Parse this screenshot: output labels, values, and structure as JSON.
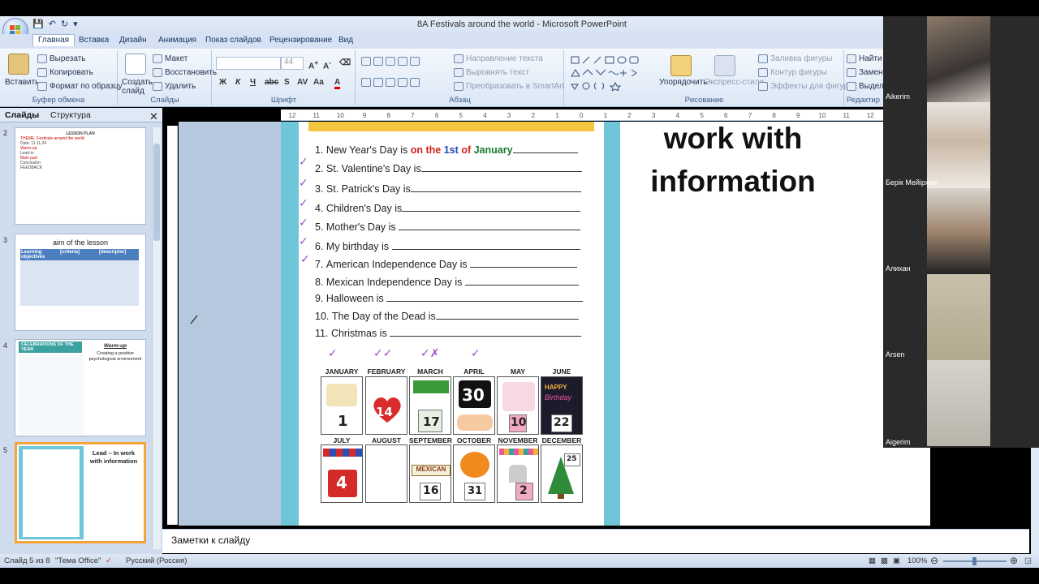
{
  "window": {
    "title": "8A Festivals around the world - Microsoft PowerPoint"
  },
  "ribbon_tabs": [
    "Главная",
    "Вставка",
    "Дизайн",
    "Анимация",
    "Показ слайдов",
    "Рецензирование",
    "Вид"
  ],
  "clipboard": {
    "paste": "Вставить",
    "cut": "Вырезать",
    "copy": "Копировать",
    "format_painter": "Формат по образцу",
    "label": "Буфер обмена"
  },
  "slides_group": {
    "create": "Создать слайд",
    "layout": "Макет",
    "reset": "Восстановить",
    "delete": "Удалить",
    "label": "Слайды"
  },
  "font_group": {
    "size": "44",
    "label": "Шрифт"
  },
  "paragraph_group": {
    "text_direction": "Направление текста",
    "align_text": "Выровнять текст",
    "smartart": "Преобразовать в SmartArt",
    "label": "Абзац"
  },
  "drawing_group": {
    "arrange": "Упорядочить",
    "quick_styles": "Экспресс-стили",
    "shape_fill": "Заливка фигуры",
    "shape_outline": "Контур фигуры",
    "shape_effects": "Эффекты для фигур",
    "label": "Рисование"
  },
  "editing_group": {
    "find": "Найти",
    "replace": "Замен",
    "select": "Выдел",
    "label": "Редактир"
  },
  "left_panel": {
    "tab_slides": "Слайды",
    "tab_outline": "Структура"
  },
  "thumbnails": [
    {
      "num": "2",
      "lines": [
        "LESSON PLAN",
        "THEME: Festivals around the world",
        "Date: 11.11.24",
        "Warm-up",
        "Lead-in",
        "Main part",
        "Conclusion",
        "FEEDBACK"
      ]
    },
    {
      "num": "3",
      "title": "aim of the lesson",
      "headers": [
        "Learning objectives",
        "[criteria]",
        "[descriptor]"
      ]
    },
    {
      "num": "4",
      "title": "CELEBRATIONS OF THE YEAR",
      "side_title": "Warm-up",
      "side_text": "Creating a positive psychological environment"
    },
    {
      "num": "5",
      "title": "Lead – In work with information"
    }
  ],
  "worksheet": {
    "questions": [
      {
        "n": "1.",
        "text": "New Year's Day is"
      },
      {
        "n": "2.",
        "text": "St. Valentine's Day is"
      },
      {
        "n": "3.",
        "text": "St. Patrick's Day is"
      },
      {
        "n": "4.",
        "text": "Children's Day is"
      },
      {
        "n": "5.",
        "text": "Mother's Day is"
      },
      {
        "n": "6.",
        "text": "My birthday is"
      },
      {
        "n": "7.",
        "text": "American Independence Day is"
      },
      {
        "n": "8.",
        "text": "Mexican Independence Day is"
      },
      {
        "n": "9.",
        "text": "Halloween is"
      },
      {
        "n": "10.",
        "text": "The Day of the Dead is"
      },
      {
        "n": "11.",
        "text": "Christmas is"
      }
    ],
    "answer1": {
      "on_the": "on the",
      "first": "1st",
      "of": "of",
      "january": "January"
    },
    "months_row1": [
      "JANUARY",
      "FEBRUARY",
      "MARCH",
      "APRIL",
      "MAY",
      "JUNE"
    ],
    "months_row2": [
      "JULY",
      "AUGUST",
      "SEPTEMBER",
      "OCTOBER",
      "NOVEMBER",
      "DECEMBER"
    ],
    "cal_numbers": {
      "jan": "1",
      "feb": "14",
      "mar": "17",
      "apr": "30",
      "may": "10",
      "jun": "22",
      "jul": "4",
      "sep": "16",
      "oct": "31",
      "nov": "2",
      "dec": "25"
    },
    "cal_labels": {
      "happy": "HAPPY",
      "birthday": "Birthday",
      "mexican": "MEXICAN"
    }
  },
  "slide_text": {
    "line1": "work with",
    "line2": "information"
  },
  "notes": {
    "placeholder": "Заметки к слайду"
  },
  "status": {
    "slide": "Слайд 5 из 8",
    "theme": "\"Тема Office\"",
    "lang": "Русский (Россия)",
    "zoom": "100%"
  },
  "participants": [
    "Aikerim",
    "Берік Мейіржан",
    "Алихан",
    "Arsen",
    "Aigerim"
  ],
  "ruler_marks": [
    "12",
    "11",
    "10",
    "9",
    "8",
    "7",
    "6",
    "5",
    "4",
    "3",
    "2",
    "1",
    "0",
    "1",
    "2",
    "3",
    "4",
    "5",
    "6",
    "7",
    "8",
    "9",
    "10",
    "11",
    "12"
  ]
}
